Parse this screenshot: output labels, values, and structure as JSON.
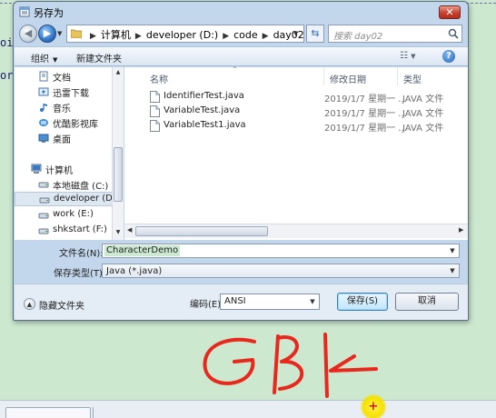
{
  "background": {
    "fragments": [
      "oi",
      "or"
    ]
  },
  "dialog": {
    "title": "另存为",
    "close_label": "✕"
  },
  "address": {
    "crumbs": [
      "计算机",
      "developer (D:)",
      "code",
      "day02"
    ],
    "search_placeholder": "搜索 day02"
  },
  "toolbar": {
    "organize_label": "组织",
    "new_folder_label": "新建文件夹"
  },
  "nav": {
    "items": [
      {
        "label": "文档",
        "icon": "document-library-icon"
      },
      {
        "label": "迅雷下载",
        "icon": "thunder-download-icon"
      },
      {
        "label": "音乐",
        "icon": "music-icon"
      },
      {
        "label": "优酷影视库",
        "icon": "video-library-icon"
      },
      {
        "label": "桌面",
        "icon": "desktop-icon"
      },
      {
        "label": "计算机",
        "icon": "computer-icon"
      },
      {
        "label": "本地磁盘 (C:)",
        "icon": "drive-icon"
      },
      {
        "label": "developer (D:)",
        "icon": "drive-icon",
        "selected": true
      },
      {
        "label": "work (E:)",
        "icon": "drive-icon"
      },
      {
        "label": "shkstart (F:)",
        "icon": "drive-icon"
      }
    ]
  },
  "files": {
    "columns": {
      "name": "名称",
      "date": "修改日期",
      "type": "类型"
    },
    "rows": [
      {
        "name": "IdentifierTest.java",
        "date": "2019/1/7 星期一 ...",
        "type": "JAVA 文件"
      },
      {
        "name": "VariableTest.java",
        "date": "2019/1/7 星期一 ...",
        "type": "JAVA 文件"
      },
      {
        "name": "VariableTest1.java",
        "date": "2019/1/7 星期一 ...",
        "type": "JAVA 文件"
      }
    ]
  },
  "form": {
    "filename_label": "文件名(N):",
    "filename_value": "CharacterDemo",
    "filetype_label": "保存类型(T):",
    "filetype_value": "Java (*.java)"
  },
  "bottom": {
    "hide_folders_label": "隐藏文件夹",
    "encoding_label": "编码(E):",
    "encoding_value": "ANSI",
    "save_label": "保存(S)",
    "cancel_label": "取消"
  },
  "annotation": {
    "text": "GBK",
    "color": "#e8281c"
  },
  "colors": {
    "desktop_bg": "#cce8cf",
    "accent": "#2f75c9"
  }
}
